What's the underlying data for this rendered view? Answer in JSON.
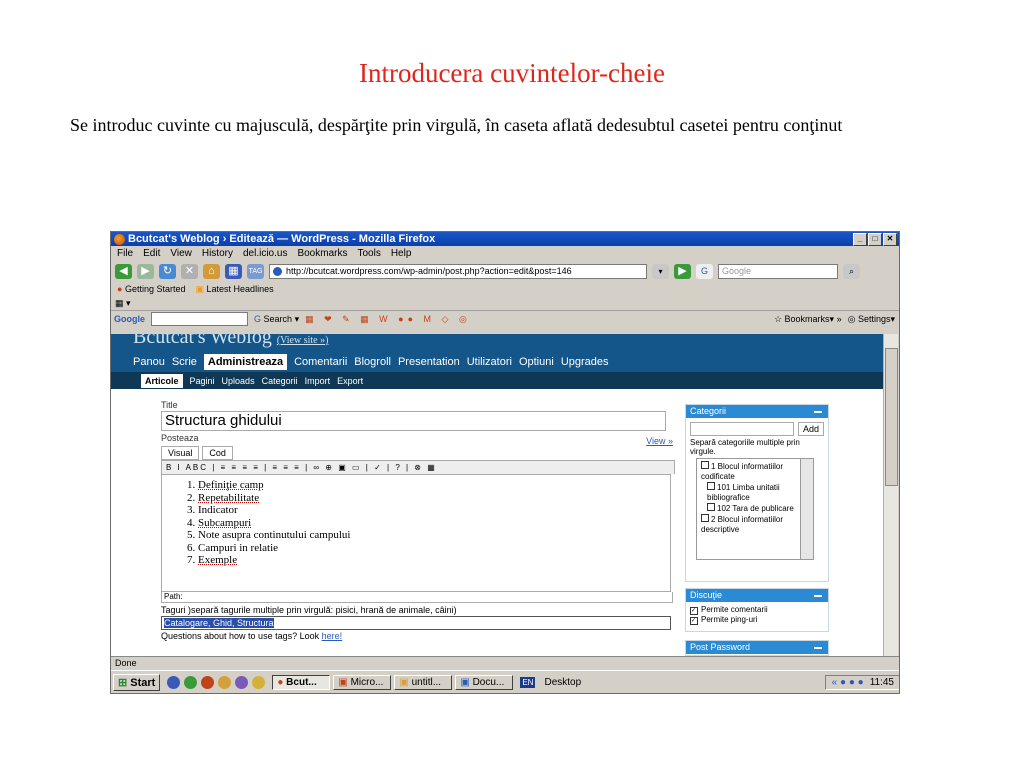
{
  "slide": {
    "title": "Introducera cuvintelor-cheie",
    "body": "Se introduc cuvinte cu majusculă, despărţite prin virgulă, în caseta aflată dedesubtul casetei pentru conţinut"
  },
  "window": {
    "title": "Bcutcat's Weblog › Editează — WordPress - Mozilla Firefox"
  },
  "menu": [
    "File",
    "Edit",
    "View",
    "History",
    "del.icio.us",
    "Bookmarks",
    "Tools",
    "Help"
  ],
  "nav": {
    "url": "http://bcutcat.wordpress.com/wp-admin/post.php?action=edit&post=146",
    "search_placeholder": "Google"
  },
  "bookmarks": [
    "Getting Started",
    "Latest Headlines"
  ],
  "googlebar": {
    "label": "Google",
    "search": "Search",
    "bookmarks": "Bookmarks",
    "settings": "Settings"
  },
  "wp": {
    "blog_title": "Bcutcat's Weblog",
    "view_site": "(View site »)",
    "nav": [
      "Panou",
      "Scrie",
      "Administreaza",
      "Comentarii",
      "Blogroll",
      "Presentation",
      "Utilizatori",
      "Optiuni",
      "Upgrades"
    ],
    "subnav": [
      "Articole",
      "Pagini",
      "Uploads",
      "Categorii",
      "Import",
      "Export"
    ],
    "title_label": "Title",
    "post_title": "Structura ghidului",
    "post_label": "Posteaza",
    "tabs": [
      "Visual",
      "Cod"
    ],
    "view_link": "View »",
    "toolbar": "B I ABC | ≡ ≡ ≡ ≡ | ≡ ≡ ≡ | ∞ ⊕ ▣ ▭ | ✓ | ? | ⊗ ▦",
    "list": [
      "Definiţie camp",
      "Repetabilitate",
      "Indicator",
      "Subcampuri",
      "Note asupra continutului campului",
      "Campuri in relatie",
      "Exemple"
    ],
    "path": "Path:",
    "tags_label": "Taguri )separă tagurile multiple prin virgulă: pisici, hrană de animale, câini)",
    "tags_value": "Catalogare, Ghid, Structura",
    "tags_help": "Questions about how to use tags? Look",
    "tags_help_link": "here!",
    "categories": {
      "header": "Categorii",
      "add": "Add",
      "note": "Separă categoriile multiple prin virgule.",
      "items": [
        "1 Blocul informatiilor codificate",
        "101 Limba unitatii bibliografice",
        "102 Tara de publicare",
        "2 Blocul informatiilor descriptive"
      ]
    },
    "discussion": {
      "header": "Discuţie",
      "items": [
        "Permite comentarii",
        "Permite ping-uri"
      ]
    },
    "next_header": "Post Password"
  },
  "status": "Done",
  "taskbar": {
    "start": "Start",
    "tasks": [
      "Bcut...",
      "Micro...",
      "untitl...",
      "Docu..."
    ],
    "lang": "EN",
    "desktop": "Desktop",
    "clock": "11:45"
  }
}
